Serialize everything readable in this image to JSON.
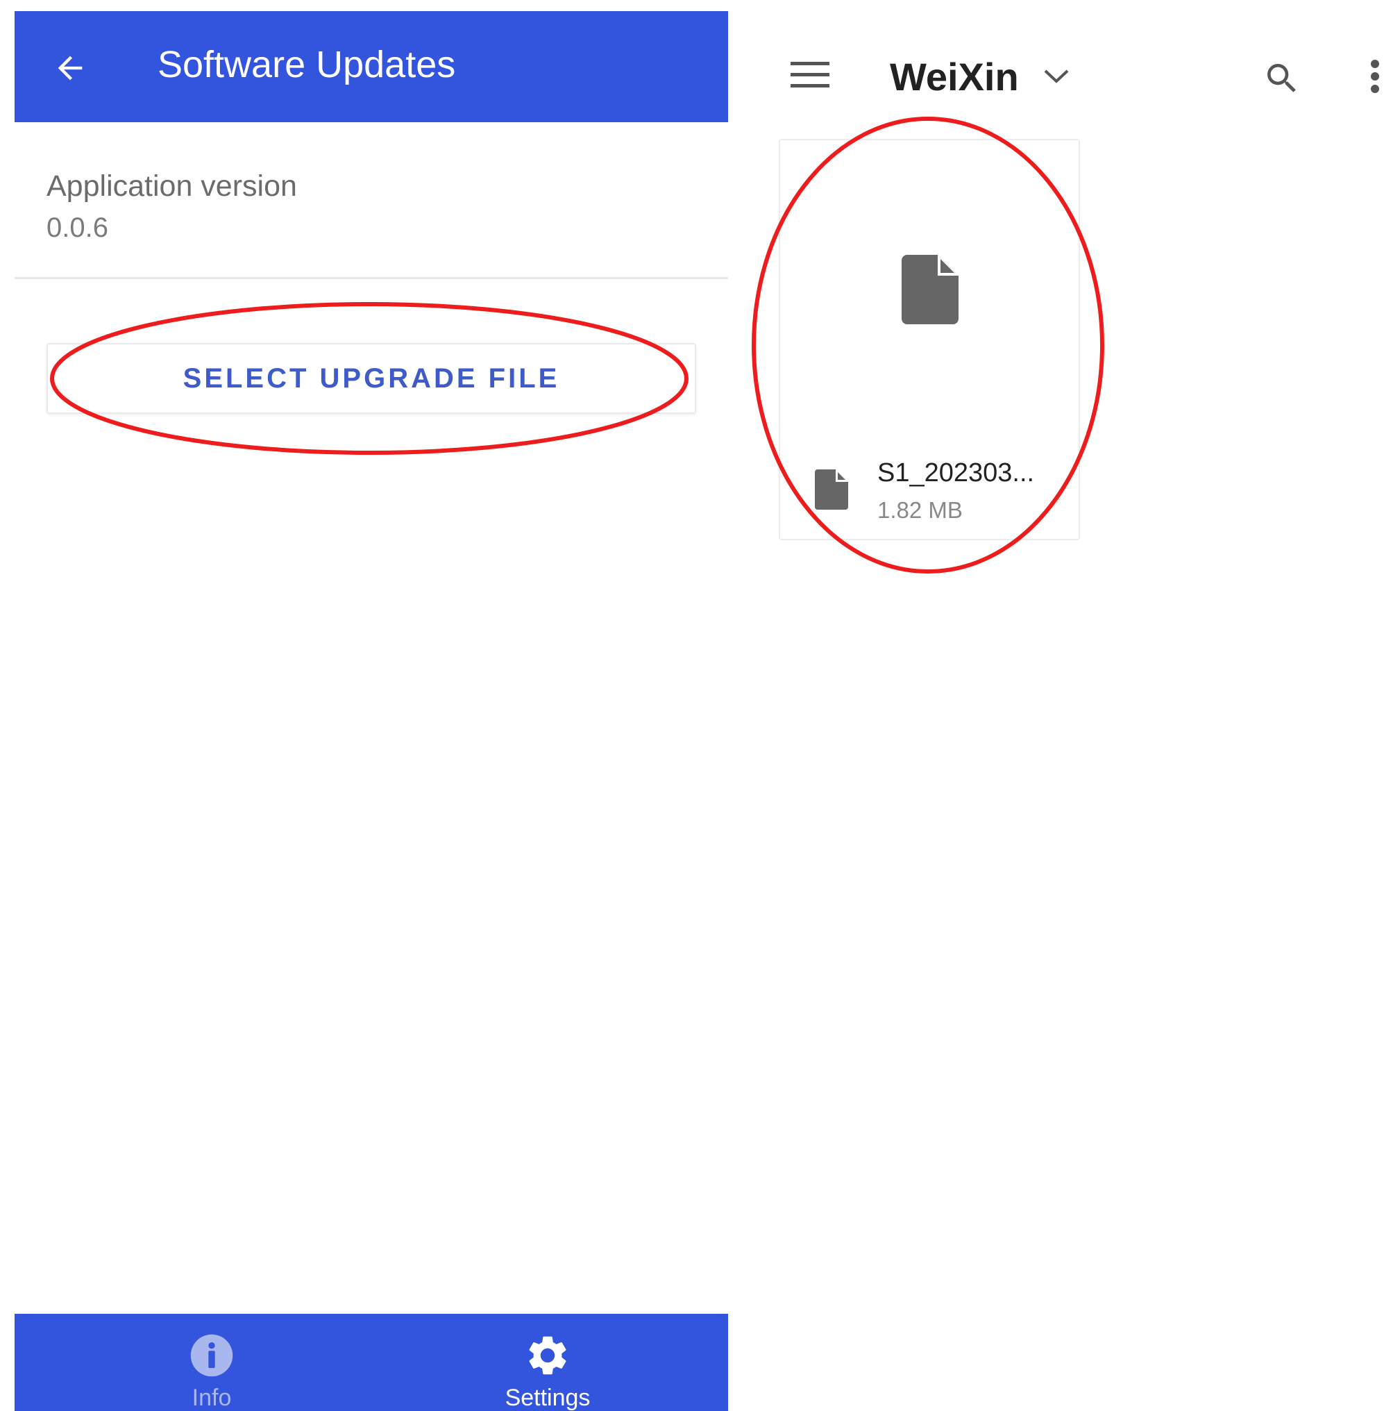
{
  "left_screen": {
    "app_bar": {
      "title": "Software Updates",
      "back_icon": "arrow-back-icon",
      "color": "#3355dd"
    },
    "preference": {
      "title": "Application version",
      "summary": "0.0.6"
    },
    "upgrade_button": {
      "label": "SELECT UPGRADE FILE",
      "text_color": "#3f5bc9"
    },
    "bottom_nav": {
      "items": [
        {
          "label": "Info",
          "icon": "info-icon",
          "active": false
        },
        {
          "label": "Settings",
          "icon": "gear-icon",
          "active": true
        }
      ]
    }
  },
  "right_screen": {
    "toolbar": {
      "menu_icon": "hamburger-menu-icon",
      "title": "WeiXin",
      "dropdown_icon": "chevron-down-icon",
      "search_icon": "search-icon",
      "more_icon": "more-vert-icon"
    },
    "files": [
      {
        "name": "S1_202303...",
        "size": "1.82 MB",
        "icon": "file-icon"
      }
    ]
  },
  "annotation_color": "#ee1c1c"
}
